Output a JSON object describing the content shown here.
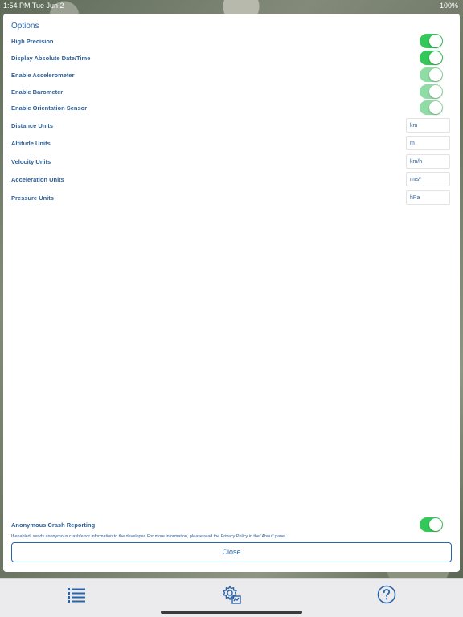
{
  "statusbar": {
    "time": "1:54 PM  Tue Jun 2",
    "battery": "100%"
  },
  "panel": {
    "title": "Options",
    "toggles": [
      {
        "label": "High Precision",
        "on": true,
        "enabled": true
      },
      {
        "label": "Display Absolute Date/Time",
        "on": true,
        "enabled": true
      },
      {
        "label": "Enable Accelerometer",
        "on": true,
        "enabled": false
      },
      {
        "label": "Enable Barometer",
        "on": true,
        "enabled": false
      },
      {
        "label": "Enable Orientation Sensor",
        "on": true,
        "enabled": false
      }
    ],
    "units": [
      {
        "label": "Distance Units",
        "value": "km"
      },
      {
        "label": "Altitude Units",
        "value": "m"
      },
      {
        "label": "Velocity Units",
        "value": "km/h"
      },
      {
        "label": "Acceleration Units",
        "value": "m/s²"
      },
      {
        "label": "Pressure Units",
        "value": "hPa"
      }
    ],
    "crash": {
      "label": "Anonymous Crash Reporting",
      "on": true,
      "description": "If enabled, sends anonymous crash/error information to the developer. For more information, please read the Privacy Policy in the 'About' panel."
    },
    "close_label": "Close"
  },
  "tabbar": {
    "icons": [
      "list-icon",
      "settings-icon",
      "help-icon"
    ]
  },
  "colors": {
    "accent": "#2a64a8",
    "toggle_on": "#34c759",
    "toggle_disabled": "#8fdca5"
  }
}
